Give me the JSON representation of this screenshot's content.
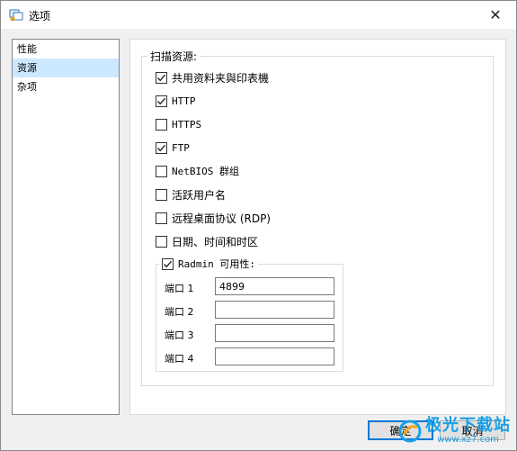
{
  "window": {
    "title": "选项",
    "close_glyph": "✕"
  },
  "sidebar": {
    "items": [
      {
        "label": "性能",
        "selected": false
      },
      {
        "label": "资源",
        "selected": true
      },
      {
        "label": "杂项",
        "selected": false
      }
    ]
  },
  "resources": {
    "group_label": "扫描资源:",
    "options": [
      {
        "label": "共用资料夹與印表機",
        "checked": true
      },
      {
        "label": "HTTP",
        "checked": true
      },
      {
        "label": "HTTPS",
        "checked": false
      },
      {
        "label": "FTP",
        "checked": true
      },
      {
        "label": "NetBIOS 群组",
        "checked": false
      },
      {
        "label": "活跃用户名",
        "checked": false
      },
      {
        "label": "远程桌面协议 (RDP)",
        "checked": false
      },
      {
        "label": "日期、时间和时区",
        "checked": false
      }
    ],
    "radmin": {
      "label": "Radmin 可用性:",
      "checked": true,
      "ports": [
        {
          "label": "端口 1",
          "value": "4899"
        },
        {
          "label": "端口 2",
          "value": ""
        },
        {
          "label": "端口 3",
          "value": ""
        },
        {
          "label": "端口 4",
          "value": ""
        }
      ]
    }
  },
  "buttons": {
    "ok": "确定",
    "cancel": "取消"
  },
  "watermark": {
    "title": "极光下载站",
    "url": "www.xz7.com"
  },
  "colors": {
    "selection": "#cce8ff",
    "accent": "#0078d7",
    "watermark": "#1aa0e6"
  }
}
